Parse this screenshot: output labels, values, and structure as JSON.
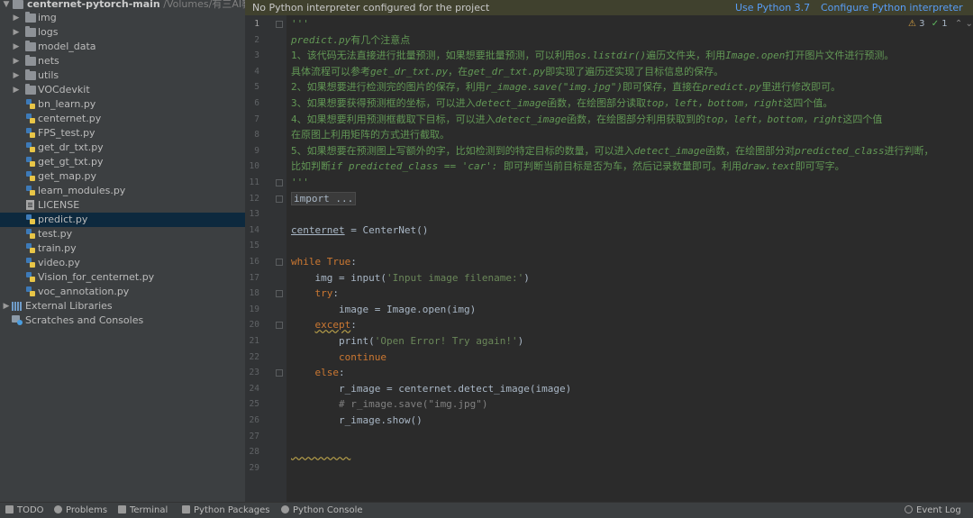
{
  "sidebar": {
    "root": {
      "name": "centernet-pytorch-main",
      "path": "/Volumes/有三AI教学"
    },
    "folders": [
      "img",
      "logs",
      "model_data",
      "nets",
      "utils",
      "VOCdevkit"
    ],
    "files": [
      {
        "name": "bn_learn.py",
        "type": "py"
      },
      {
        "name": "centernet.py",
        "type": "py"
      },
      {
        "name": "FPS_test.py",
        "type": "py"
      },
      {
        "name": "get_dr_txt.py",
        "type": "py"
      },
      {
        "name": "get_gt_txt.py",
        "type": "py"
      },
      {
        "name": "get_map.py",
        "type": "py"
      },
      {
        "name": "learn_modules.py",
        "type": "py"
      },
      {
        "name": "LICENSE",
        "type": "txt"
      },
      {
        "name": "predict.py",
        "type": "py",
        "selected": true
      },
      {
        "name": "test.py",
        "type": "py"
      },
      {
        "name": "train.py",
        "type": "py"
      },
      {
        "name": "video.py",
        "type": "py"
      },
      {
        "name": "Vision_for_centernet.py",
        "type": "py"
      },
      {
        "name": "voc_annotation.py",
        "type": "py"
      }
    ],
    "external_libraries": "External Libraries",
    "scratches": "Scratches and Consoles"
  },
  "banner": {
    "message": "No Python interpreter configured for the project",
    "use_python": "Use Python 3.7",
    "configure": "Configure Python interpreter"
  },
  "inspection": {
    "warnings": "3",
    "ok": "1"
  },
  "editor": {
    "current_line": 1,
    "lines": [
      [
        {
          "c": "doc",
          "t": "'''"
        }
      ],
      [
        {
          "c": "doc",
          "t": "predict.py"
        },
        {
          "c": "doc-cn",
          "t": "有几个注意点"
        }
      ],
      [
        {
          "c": "doc-cn",
          "t": "1、该代码无法直接进行批量预测，如果想要批量预测，可以利用"
        },
        {
          "c": "doc",
          "t": "os.listdir()"
        },
        {
          "c": "doc-cn",
          "t": "遍历文件夹，利用"
        },
        {
          "c": "doc",
          "t": "Image.open"
        },
        {
          "c": "doc-cn",
          "t": "打开图片文件进行预测。"
        }
      ],
      [
        {
          "c": "doc-cn",
          "t": "具体流程可以参考"
        },
        {
          "c": "doc",
          "t": "get_dr_txt.py"
        },
        {
          "c": "doc-cn",
          "t": "，在"
        },
        {
          "c": "doc",
          "t": "get_dr_txt.py"
        },
        {
          "c": "doc-cn",
          "t": "即实现了遍历还实现了目标信息的保存。"
        }
      ],
      [
        {
          "c": "doc-cn",
          "t": "2、如果想要进行检测完的图片的保存，利用"
        },
        {
          "c": "doc",
          "t": "r_image.save(\"img.jpg\")"
        },
        {
          "c": "doc-cn",
          "t": "即可保存，直接在"
        },
        {
          "c": "doc",
          "t": "predict.py"
        },
        {
          "c": "doc-cn",
          "t": "里进行修改即可。"
        }
      ],
      [
        {
          "c": "doc-cn",
          "t": "3、如果想要获得预测框的坐标，可以进入"
        },
        {
          "c": "doc",
          "t": "detect_image"
        },
        {
          "c": "doc-cn",
          "t": "函数，在绘图部分读取"
        },
        {
          "c": "doc",
          "t": "top，left，bottom，right"
        },
        {
          "c": "doc-cn",
          "t": "这四个值。"
        }
      ],
      [
        {
          "c": "doc-cn",
          "t": "4、如果想要利用预测框截取下目标，可以进入"
        },
        {
          "c": "doc",
          "t": "detect_image"
        },
        {
          "c": "doc-cn",
          "t": "函数，在绘图部分利用获取到的"
        },
        {
          "c": "doc",
          "t": "top，left，bottom，right"
        },
        {
          "c": "doc-cn",
          "t": "这四个值"
        }
      ],
      [
        {
          "c": "doc-cn",
          "t": "在原图上利用矩阵的方式进行截取。"
        }
      ],
      [
        {
          "c": "doc-cn",
          "t": "5、如果想要在预测图上写额外的字，比如检测到的特定目标的数量，可以进入"
        },
        {
          "c": "doc",
          "t": "detect_image"
        },
        {
          "c": "doc-cn",
          "t": "函数，在绘图部分对"
        },
        {
          "c": "doc",
          "t": "predicted_class"
        },
        {
          "c": "doc-cn",
          "t": "进行判断，"
        }
      ],
      [
        {
          "c": "doc-cn",
          "t": "比如判断"
        },
        {
          "c": "doc",
          "t": "if predicted_class == 'car':"
        },
        {
          "c": "doc-cn",
          "t": " 即可判断当前目标是否为车，然后记录数量即可。利用"
        },
        {
          "c": "doc",
          "t": "draw.text"
        },
        {
          "c": "doc-cn",
          "t": "即可写字。"
        }
      ],
      [
        {
          "c": "doc",
          "t": "'''"
        }
      ],
      [
        {
          "c": "folded",
          "t": "import ..."
        }
      ],
      [],
      [
        {
          "c": "underline",
          "t": "centernet"
        },
        {
          "c": "",
          "t": " = CenterNet()"
        }
      ],
      [],
      [
        {
          "c": "kw",
          "t": "while "
        },
        {
          "c": "kw",
          "t": "True"
        },
        {
          "c": "",
          "t": ":"
        }
      ],
      [
        {
          "c": "",
          "t": "    img = input("
        },
        {
          "c": "str",
          "t": "'Input image filename:'"
        },
        {
          "c": "",
          "t": ")"
        }
      ],
      [
        {
          "c": "kw",
          "t": "    try"
        },
        {
          "c": "",
          "t": ":"
        }
      ],
      [
        {
          "c": "",
          "t": "        image = Image.open(img)"
        }
      ],
      [
        {
          "c": "",
          "t": "    "
        },
        {
          "c": "kw warn-underline",
          "t": "except"
        },
        {
          "c": "",
          "t": ":"
        }
      ],
      [
        {
          "c": "",
          "t": "        print("
        },
        {
          "c": "str",
          "t": "'Open Error! Try again!'"
        },
        {
          "c": "",
          "t": ")"
        }
      ],
      [
        {
          "c": "kw",
          "t": "        continue"
        }
      ],
      [
        {
          "c": "kw",
          "t": "    else"
        },
        {
          "c": "",
          "t": ":"
        }
      ],
      [
        {
          "c": "",
          "t": "        r_image = centernet.detect_image(image)"
        }
      ],
      [
        {
          "c": "cmt",
          "t": "        # r_image.save(\"img.jpg\")"
        }
      ],
      [
        {
          "c": "",
          "t": "        r_image.show()"
        }
      ],
      [],
      [
        {
          "c": "warn-underline",
          "t": "          "
        }
      ],
      []
    ]
  },
  "statusbar": {
    "todo": "TODO",
    "problems": "Problems",
    "terminal": "Terminal",
    "python_packages": "Python Packages",
    "python_console": "Python Console",
    "event_log": "Event Log"
  }
}
